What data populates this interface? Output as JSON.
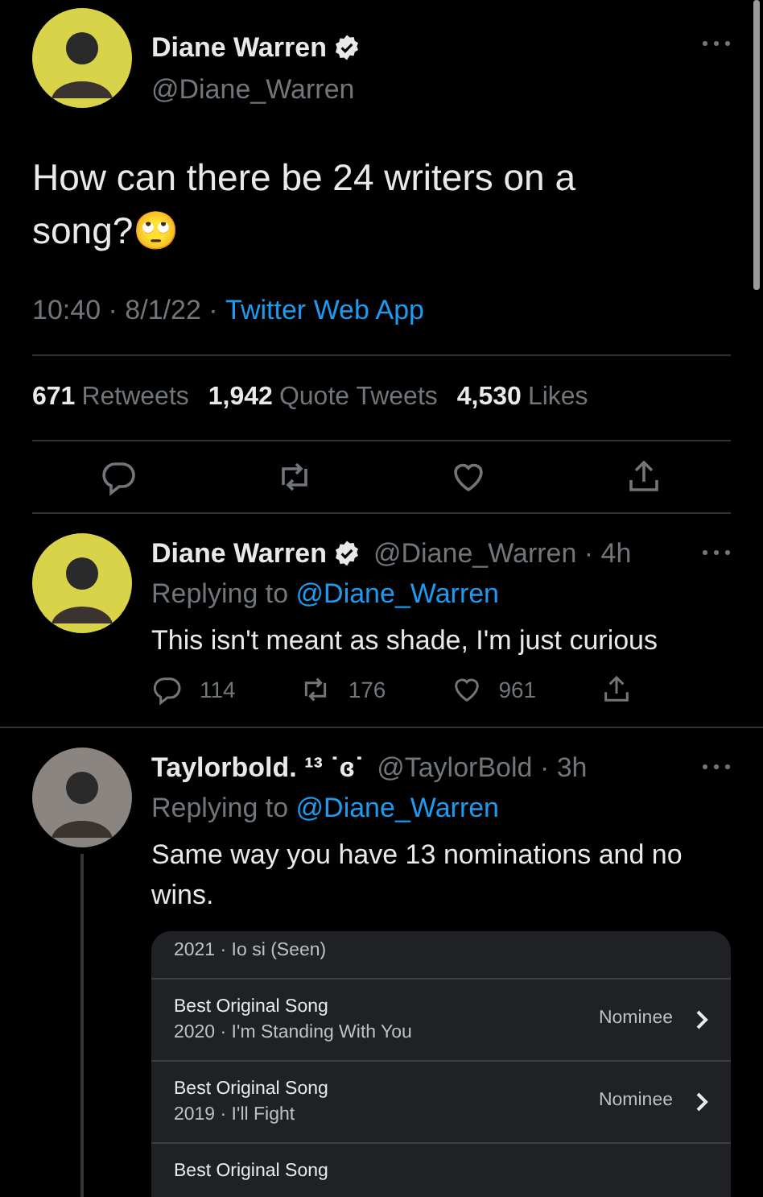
{
  "tweet": {
    "name": "Diane Warren",
    "verified": true,
    "handle": "@Diane_Warren",
    "text": "How can there be 24 writers on a song?🙄",
    "time": "10:40 · 8/1/22 · ",
    "source": "Twitter Web App",
    "stats": [
      {
        "count": "671",
        "label": "Retweets"
      },
      {
        "count": "1,942",
        "label": "Quote Tweets"
      },
      {
        "count": "4,530",
        "label": "Likes"
      }
    ]
  },
  "replies": [
    {
      "name": "Diane Warren",
      "verified": true,
      "handle": "@Diane_Warren · 4h",
      "replying_to": "Replying to ",
      "reply_handle": "@Diane_Warren",
      "text": "This isn't meant as shade, I'm just curious",
      "counts": [
        "114",
        "176",
        "961"
      ],
      "thread": false
    },
    {
      "name": "Taylorbold. ¹³ ˙ɞ˙",
      "verified": false,
      "handle": "@TaylorBold · 3h",
      "replying_to": "Replying to ",
      "reply_handle": "@Diane_Warren",
      "text": "Same way you have 13 nominations and no wins.",
      "thread": true,
      "card": [
        {
          "line1": "2021 · Io si (Seen)"
        },
        {
          "line0": "Best Original Song",
          "line1": "2020 · I'm Standing With You",
          "result": "Nominee"
        },
        {
          "line0": "Best Original Song",
          "line1": "2019 · I'll Fight",
          "result": "Nominee"
        },
        {
          "line0": "Best Original Song"
        }
      ]
    }
  ]
}
